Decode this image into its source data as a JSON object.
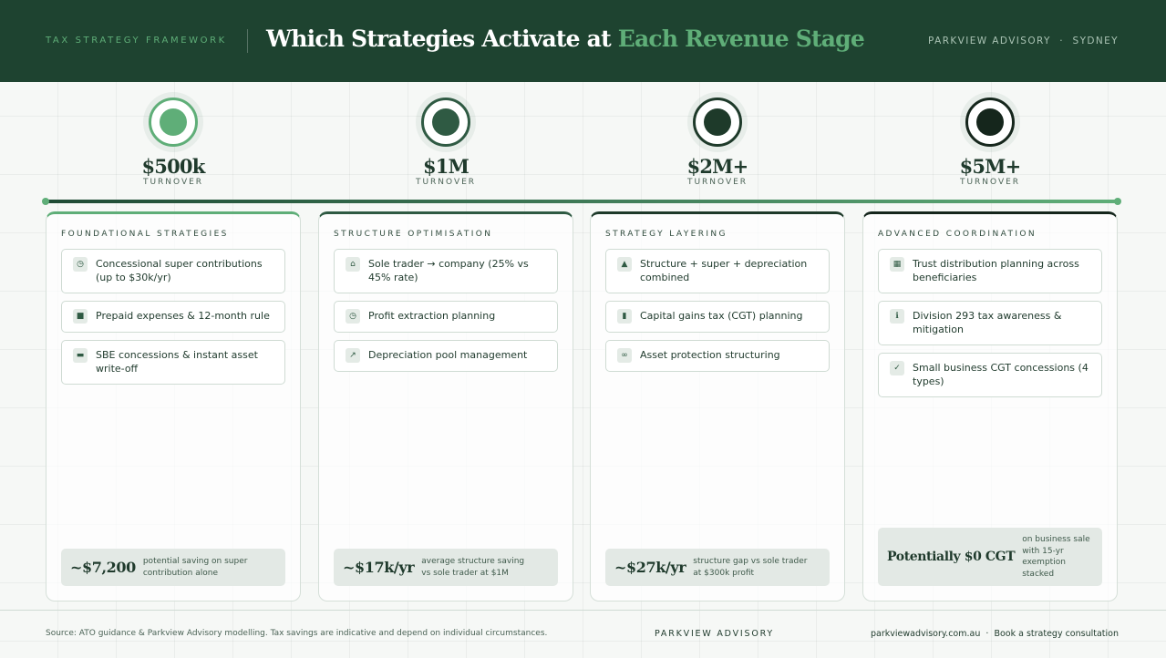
{
  "header": {
    "eyebrow": "TAX STRATEGY FRAMEWORK",
    "title_main": "Which Strategies Activate at ",
    "title_accent": "Each Revenue Stage",
    "brand": "PARKVIEW ADVISORY  ·  SYDNEY"
  },
  "colors": {
    "header_bg": "#1e4330",
    "accent": "#5fae78",
    "stage_1": "#5fae78",
    "stage_2": "#2f5a43",
    "stage_3": "#1e3a2a",
    "stage_4": "#15261c"
  },
  "stages": [
    {
      "value": "$500k",
      "label": "TURNOVER",
      "card_title": "FOUNDATIONAL STRATEGIES",
      "items": [
        {
          "icon": "clock-icon",
          "text": "Concessional super contributions (up to $30k/yr)"
        },
        {
          "icon": "briefcase-icon",
          "text": "Prepaid expenses & 12-month rule"
        },
        {
          "icon": "card-icon",
          "text": "SBE concessions & instant asset write-off"
        }
      ],
      "saving_value": "~$7,200",
      "saving_note": "potential saving on super contribution alone"
    },
    {
      "value": "$1M",
      "label": "TURNOVER",
      "card_title": "STRUCTURE OPTIMISATION",
      "items": [
        {
          "icon": "home-icon",
          "text": "Sole trader → company (25% vs 45% rate)"
        },
        {
          "icon": "clock-icon",
          "text": "Profit extraction planning"
        },
        {
          "icon": "trend-icon",
          "text": "Depreciation pool management"
        }
      ],
      "saving_value": "~$17k/yr",
      "saving_note": "average structure saving vs sole trader at $1M"
    },
    {
      "value": "$2M+",
      "label": "TURNOVER",
      "card_title": "STRATEGY LAYERING",
      "items": [
        {
          "icon": "triangle-icon",
          "text": "Structure + super + depreciation combined"
        },
        {
          "icon": "bar-chart-icon",
          "text": "Capital gains tax (CGT) planning"
        },
        {
          "icon": "link-icon",
          "text": "Asset protection structuring"
        }
      ],
      "saving_value": "~$27k/yr",
      "saving_note": "structure gap vs sole trader at $300k profit"
    },
    {
      "value": "$5M+",
      "label": "TURNOVER",
      "card_title": "ADVANCED COORDINATION",
      "items": [
        {
          "icon": "grid-icon",
          "text": "Trust distribution planning across beneficiaries"
        },
        {
          "icon": "info-icon",
          "text": "Division 293 tax awareness & mitigation"
        },
        {
          "icon": "check-icon",
          "text": "Small business CGT concessions (4 types)"
        }
      ],
      "saving_value": "Potentially $0 CGT",
      "saving_note": "on business sale with 15-yr exemption stacked"
    }
  ],
  "footer": {
    "source": "Source: ATO guidance & Parkview Advisory modelling. Tax savings are indicative and depend on individual circumstances.",
    "brand": "PARKVIEW ADVISORY",
    "contact": "parkviewadvisory.com.au  ·  Book a strategy consultation"
  }
}
